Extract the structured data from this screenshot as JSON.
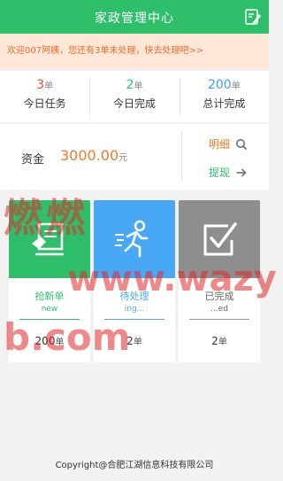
{
  "header": {
    "title": "家政管理中心",
    "edit_icon": "edit-icon"
  },
  "notice": "欢迎007阿姨，您还有3单未处理，快去处理吧>>",
  "stats": [
    {
      "num": "3",
      "unit": "单",
      "label": "今日任务",
      "color": "#ef4b3c"
    },
    {
      "num": "2",
      "unit": "单",
      "label": "今日完成",
      "color": "#2fbf6b"
    },
    {
      "num": "200",
      "unit": "单",
      "label": "总计完成",
      "color": "#3da2ea"
    }
  ],
  "funds": {
    "label": "资金",
    "amount": "3000.00",
    "unit": "元",
    "detail_label": "明细",
    "withdraw_label": "提现"
  },
  "cards": [
    {
      "name": "抢新单",
      "sub": "new",
      "count": "200",
      "unit": "单",
      "tile_color": "#2fbf6b",
      "text_color": "#2fbf6b",
      "icon": "grab-order-icon"
    },
    {
      "name": "待处理",
      "sub": "ing...",
      "count": "2",
      "unit": "单",
      "tile_color": "#49a8f5",
      "text_color": "#49a8f5",
      "icon": "running-person-icon"
    },
    {
      "name": "已完成",
      "sub": "...ed",
      "count": "2",
      "unit": "单",
      "tile_color": "#8e8e8e",
      "text_color": "#666666",
      "icon": "checked-box-icon"
    }
  ],
  "footer": "Copyright@合肥江湖信息科技有限公司",
  "watermark": {
    "line1": "燃燃",
    "line2": "www.wazy",
    "line3": "b.com"
  }
}
